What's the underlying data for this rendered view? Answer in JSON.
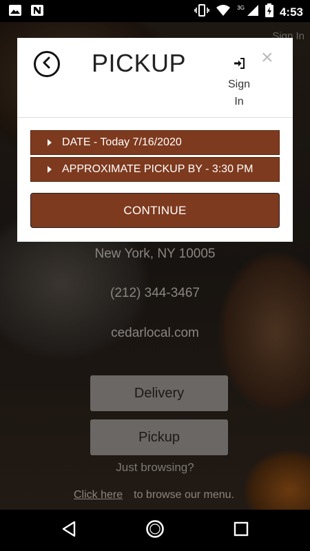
{
  "status_bar": {
    "time": "4:53",
    "network": "3G"
  },
  "background": {
    "header_signin": "Sign In",
    "address": "New York, NY 10005",
    "phone": "(212) 344-3467",
    "website": "cedarlocal.com",
    "delivery_label": "Delivery",
    "pickup_label": "Pickup",
    "browsing_prompt": "Just browsing?",
    "click_here_label": "Click here",
    "browse_menu_text": "to browse our menu."
  },
  "modal": {
    "title": "PICKUP",
    "signin_line1": "Sign",
    "signin_line2": "In",
    "close_symbol": "×",
    "date_row": "DATE - Today 7/16/2020",
    "time_row": "APPROXIMATE PICKUP BY - 3:30 PM",
    "continue_label": "CONTINUE"
  },
  "colors": {
    "accent": "#7e3a1e",
    "modal_bg": "#ffffff"
  }
}
